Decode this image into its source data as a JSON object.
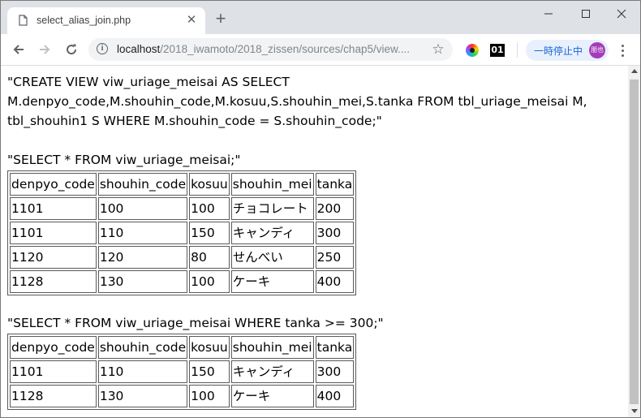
{
  "tab": {
    "title": "select_alias_join.php"
  },
  "omnibox": {
    "url_host": "localhost",
    "url_path": "/2018_iwamoto/2018_zissen/sources/chap5/view...."
  },
  "profile": {
    "label": "一時停止中",
    "avatar_text": "朋也"
  },
  "extensions": {
    "ext2_label": "01"
  },
  "page": {
    "sql1": "\"CREATE VIEW viw_uriage_meisai AS SELECT M.denpyo_code,M.shouhin_code,M.kosuu,S.shouhin_mei,S.tanka FROM tbl_uriage_meisai M, tbl_shouhin1 S WHERE M.shouhin_code = S.shouhin_code;\"",
    "sql2": "\"SELECT * FROM viw_uriage_meisai;\"",
    "table1": {
      "headers": [
        "denpyo_code",
        "shouhin_code",
        "kosuu",
        "shouhin_mei",
        "tanka"
      ],
      "rows": [
        [
          "1101",
          "100",
          "100",
          "チョコレート",
          "200"
        ],
        [
          "1101",
          "110",
          "150",
          "キャンディ",
          "300"
        ],
        [
          "1120",
          "120",
          "80",
          "せんべい",
          "250"
        ],
        [
          "1128",
          "130",
          "100",
          "ケーキ",
          "400"
        ]
      ]
    },
    "sql3": "\"SELECT * FROM viw_uriage_meisai WHERE tanka >= 300;\"",
    "table2": {
      "headers": [
        "denpyo_code",
        "shouhin_code",
        "kosuu",
        "shouhin_mei",
        "tanka"
      ],
      "rows": [
        [
          "1101",
          "110",
          "150",
          "キャンディ",
          "300"
        ],
        [
          "1128",
          "130",
          "100",
          "ケーキ",
          "400"
        ]
      ]
    }
  }
}
